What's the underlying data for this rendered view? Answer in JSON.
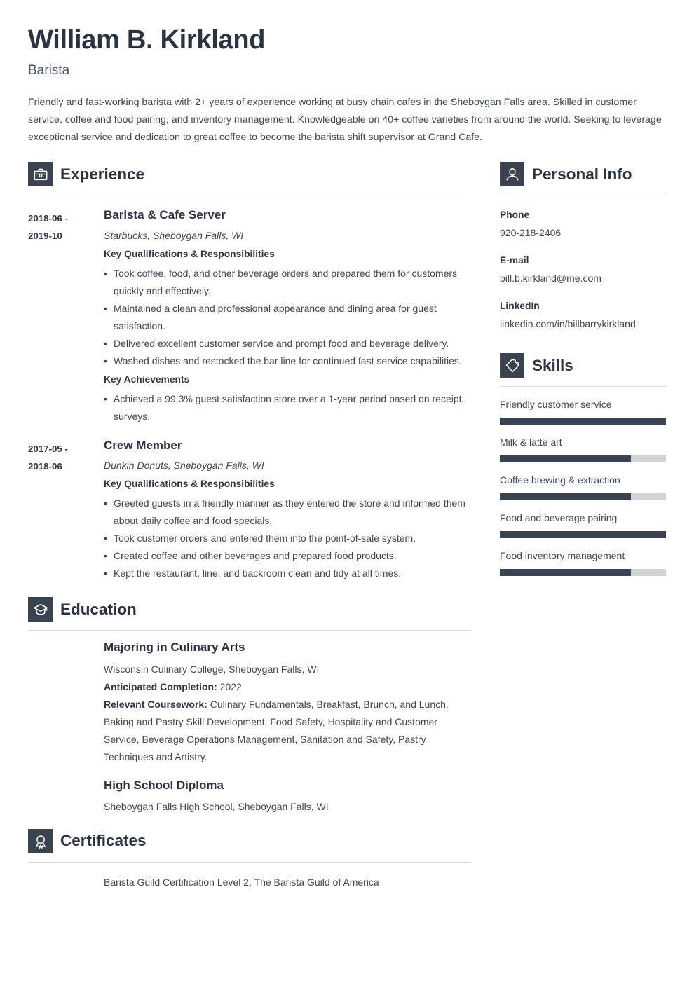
{
  "theme": {
    "accent": "#3b4250",
    "text": "#3f4752",
    "heading": "#2b3240",
    "rule": "#d3d6da",
    "track": "#d2d4d6"
  },
  "header": {
    "name": "William B. Kirkland",
    "job_title": "Barista",
    "summary": "Friendly and fast-working barista with 2+ years of experience working at busy chain cafes in the Sheboygan Falls area. Skilled in customer service, coffee and food pairing, and inventory management. Knowledgeable on 40+ coffee varieties from around the world. Seeking to leverage exceptional service and dedication to great coffee to become the barista shift supervisor at Grand Cafe."
  },
  "experience": {
    "title": "Experience",
    "icon": "briefcase-icon",
    "entries": [
      {
        "date_from": "2018-06 -",
        "date_to": "2019-10",
        "role": "Barista & Cafe Server",
        "company": "Starbucks, Sheboygan Falls, WI",
        "quals_label": "Key Qualifications & Responsibilities",
        "quals": [
          "Took coffee, food, and other beverage orders and prepared them for customers quickly and effectively.",
          "Maintained a clean and professional appearance and dining area for guest satisfaction.",
          "Delivered excellent customer service and prompt food and beverage delivery.",
          "Washed dishes and restocked the bar line for continued fast service capabilities."
        ],
        "achievements_label": "Key Achievements",
        "achievements": [
          "Achieved a 99.3% guest satisfaction store over a 1-year period based on receipt surveys."
        ]
      },
      {
        "date_from": "2017-05 -",
        "date_to": "2018-06",
        "role": "Crew Member",
        "company": "Dunkin Donuts, Sheboygan Falls, WI",
        "quals_label": "Key Qualifications & Responsibilities",
        "quals": [
          "Greeted guests in a friendly manner as they entered the store and informed them about daily coffee and food specials.",
          "Took customer orders and entered them into the point-of-sale system.",
          "Created coffee and other beverages and prepared food products.",
          "Kept the restaurant, line, and backroom clean and tidy at all times."
        ],
        "achievements_label": "",
        "achievements": []
      }
    ]
  },
  "education": {
    "title": "Education",
    "icon": "graduation-cap-icon",
    "entries": [
      {
        "degree": "Majoring in Culinary Arts",
        "school": "Wisconsin Culinary College, Sheboygan Falls, WI",
        "completion_label": "Anticipated Completion:",
        "completion_value": "2022",
        "coursework_label": "Relevant Coursework:",
        "coursework_value": "Culinary Fundamentals, Breakfast, Brunch, and Lunch, Baking and Pastry Skill Development, Food Safety, Hospitality and Customer Service, Beverage Operations Management, Sanitation and Safety, Pastry Techniques and Artistry."
      },
      {
        "degree": "High School Diploma",
        "school": "Sheboygan Falls High School, Sheboygan Falls, WI",
        "completion_label": "",
        "completion_value": "",
        "coursework_label": "",
        "coursework_value": ""
      }
    ]
  },
  "certificates": {
    "title": "Certificates",
    "icon": "award-ribbon-icon",
    "items": [
      "Barista Guild Certification Level 2, The Barista Guild of America"
    ]
  },
  "personal_info": {
    "title": "Personal Info",
    "icon": "person-icon",
    "fields": [
      {
        "label": "Phone",
        "value": "920-218-2406"
      },
      {
        "label": "E-mail",
        "value": "bill.b.kirkland@me.com"
      },
      {
        "label": "LinkedIn",
        "value": "linkedin.com/in/billbarrykirkland"
      }
    ]
  },
  "skills": {
    "title": "Skills",
    "icon": "puzzle-piece-icon",
    "items": [
      {
        "name": "Friendly customer service",
        "level": 100
      },
      {
        "name": "Milk & latte art",
        "level": 79
      },
      {
        "name": "Coffee brewing & extraction",
        "level": 79
      },
      {
        "name": "Food and beverage pairing",
        "level": 100
      },
      {
        "name": "Food inventory management",
        "level": 79
      }
    ]
  }
}
